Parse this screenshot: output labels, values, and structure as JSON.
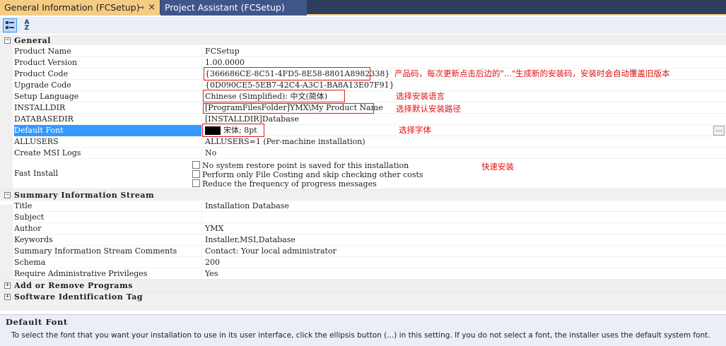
{
  "tabs": {
    "active": "General Information (FCSetup)",
    "active_pin": "⊸",
    "active_close": "×",
    "inactive": "Project Assistant (FCSetup)"
  },
  "toolbar": {
    "alpha_top": "A",
    "alpha_bottom": "Z"
  },
  "categories": {
    "general": {
      "toggle": "−",
      "name": "General"
    },
    "summary": {
      "toggle": "−",
      "name": "Summary Information Stream"
    },
    "addremove": {
      "toggle": "+",
      "name": "Add or Remove Programs"
    },
    "softwareid": {
      "toggle": "+",
      "name": "Software Identification Tag"
    }
  },
  "general": {
    "product_name": {
      "name": "Product Name",
      "value": "FCSetup"
    },
    "product_version": {
      "name": "Product Version",
      "value": "1.00.0000"
    },
    "product_code": {
      "name": "Product Code",
      "value": "{366686CE-8C51-4FD5-8E58-8801A8982338}"
    },
    "upgrade_code": {
      "name": "Upgrade Code",
      "value": "{0D090CE5-5EB7-42C4-A3C1-BA8A13E07F91}"
    },
    "setup_language": {
      "name": "Setup Language",
      "value": "Chinese (Simplified): 中文(简体)"
    },
    "installdir": {
      "name": "INSTALLDIR",
      "value": "[ProgramFilesFolder]YMX\\My Product Name"
    },
    "databasedir": {
      "name": "DATABASEDIR",
      "value": "[INSTALLDIR]Database"
    },
    "default_font": {
      "name": "Default Font",
      "value": "宋体; 8pt",
      "ellipsis": "..."
    },
    "allusers": {
      "name": "ALLUSERS",
      "value": "ALLUSERS=1 (Per-machine installation)"
    },
    "create_msi_logs": {
      "name": "Create MSI Logs",
      "value": "No"
    },
    "fast_install": {
      "name": "Fast Install",
      "options": [
        "No system restore point is saved for this installation",
        "Perform only File Costing and skip checking other costs",
        "Reduce the frequency of progress messages"
      ]
    }
  },
  "summary": {
    "title": {
      "name": "Title",
      "value": "Installation Database"
    },
    "subject": {
      "name": "Subject",
      "value": ""
    },
    "author": {
      "name": "Author",
      "value": "YMX"
    },
    "keywords": {
      "name": "Keywords",
      "value": "Installer,MSI,Database"
    },
    "comments": {
      "name": "Summary Information Stream Comments",
      "value": "Contact:  Your local administrator"
    },
    "schema": {
      "name": "Schema",
      "value": "200"
    },
    "admin": {
      "name": "Require Administrative Privileges",
      "value": "Yes"
    }
  },
  "notes": {
    "product_code": "产品码，每次更新点击后边的\"...\"生成新的安装码，安装时会自动覆盖旧版本",
    "language": "选择安装语言",
    "installdir": "选择默认安装路径",
    "font": "选择字体",
    "fast": "快速安装"
  },
  "description": {
    "title": "Default Font",
    "text": "To select the font that you want your installation to use in its user interface, click the ellipsis button (...) in this setting. If you do not select a font, the installer uses the default system font."
  },
  "colors": {
    "selection": "#3399ff",
    "annotation": "#e01010",
    "tab_active": "#f5cc84",
    "tab_bg": "#2d3f5d"
  }
}
